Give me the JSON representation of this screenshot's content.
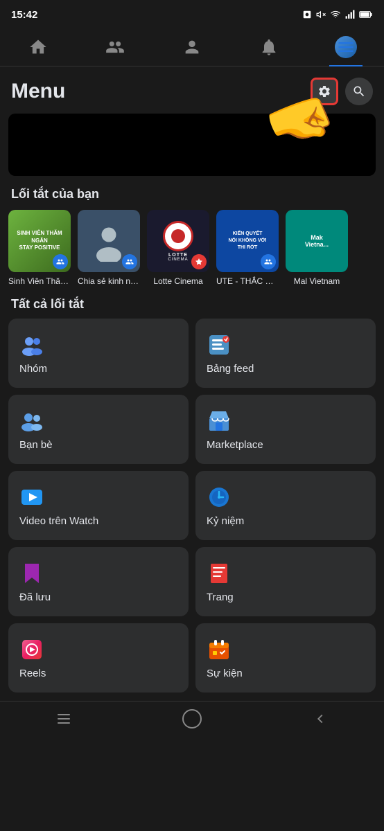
{
  "statusBar": {
    "time": "15:42",
    "icons": [
      "photo",
      "mute",
      "wifi",
      "signal",
      "battery"
    ]
  },
  "navBar": {
    "items": [
      {
        "name": "home",
        "label": "Trang chủ",
        "active": false
      },
      {
        "name": "friends",
        "label": "Bạn bè",
        "active": false
      },
      {
        "name": "profile",
        "label": "Hồ sơ",
        "active": false
      },
      {
        "name": "notifications",
        "label": "Thông báo",
        "active": false
      },
      {
        "name": "menu",
        "label": "Menu",
        "active": true
      }
    ]
  },
  "menuPage": {
    "title": "Menu",
    "settingsLabel": "⚙",
    "searchLabel": "🔍"
  },
  "shortcuts": {
    "sectionTitle": "Lối tắt của bạn",
    "items": [
      {
        "label": "Sinh Viên Thăm Ngăn",
        "type": "sinh-vien"
      },
      {
        "label": "Chia sẻ kinh nghiệ...",
        "type": "chia-se"
      },
      {
        "label": "Lotte Cinema",
        "type": "lotte"
      },
      {
        "label": "UTE - THẮC MẮC HỌC...",
        "type": "ute"
      },
      {
        "label": "Mal Vietnam",
        "type": "mal"
      }
    ],
    "allShortcutsTitle": "Tất cả lối tắt"
  },
  "menuGrid": {
    "items": [
      {
        "id": "nhom",
        "label": "Nhóm",
        "iconType": "group"
      },
      {
        "id": "bang-feed",
        "label": "Bảng feed",
        "iconType": "feed"
      },
      {
        "id": "ban-be",
        "label": "Bạn bè",
        "iconType": "friends"
      },
      {
        "id": "marketplace",
        "label": "Marketplace",
        "iconType": "marketplace"
      },
      {
        "id": "video-watch",
        "label": "Video trên Watch",
        "iconType": "video"
      },
      {
        "id": "ky-niem",
        "label": "Kỷ niệm",
        "iconType": "memories"
      },
      {
        "id": "da-luu",
        "label": "Đã lưu",
        "iconType": "saved"
      },
      {
        "id": "trang",
        "label": "Trang",
        "iconType": "pages"
      },
      {
        "id": "reels",
        "label": "Reels",
        "iconType": "reels"
      },
      {
        "id": "su-kien",
        "label": "Sự kiện",
        "iconType": "events"
      }
    ]
  },
  "bottomNav": {
    "items": [
      "menu-lines",
      "home-circle",
      "back-arrow"
    ]
  }
}
